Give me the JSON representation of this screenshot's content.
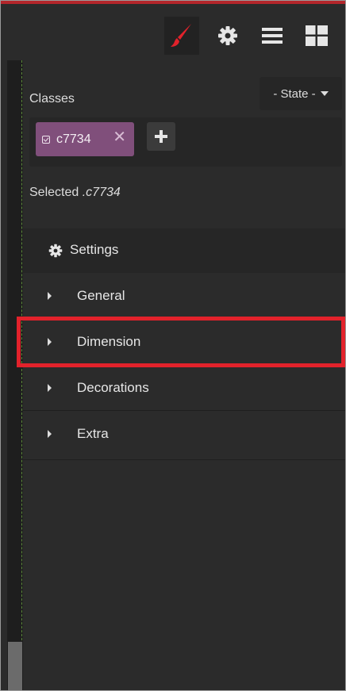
{
  "toolbar": {
    "buttons": [
      {
        "name": "style-manager-button",
        "icon": "paint-brush-icon",
        "active": true
      },
      {
        "name": "settings-button",
        "icon": "gear-icon",
        "active": false
      },
      {
        "name": "layer-manager-button",
        "icon": "bars-icon",
        "active": false
      },
      {
        "name": "blocks-button",
        "icon": "grid-icon",
        "active": false
      }
    ]
  },
  "selector": {
    "classes_label": "Classes",
    "state_label": "- State -",
    "tag": {
      "name": "c7734",
      "close": "✕"
    },
    "selected_prefix": "Selected",
    "selected_class": ".c7734"
  },
  "sectors": {
    "settings_label": "Settings",
    "items": [
      {
        "label": "General"
      },
      {
        "label": "Dimension",
        "highlighted": true
      },
      {
        "label": "Decorations"
      },
      {
        "label": "Extra"
      }
    ]
  },
  "colors": {
    "accent_red": "#e2222b",
    "tag_purple": "#804f7b",
    "panel_bg": "#2b2b2b"
  }
}
